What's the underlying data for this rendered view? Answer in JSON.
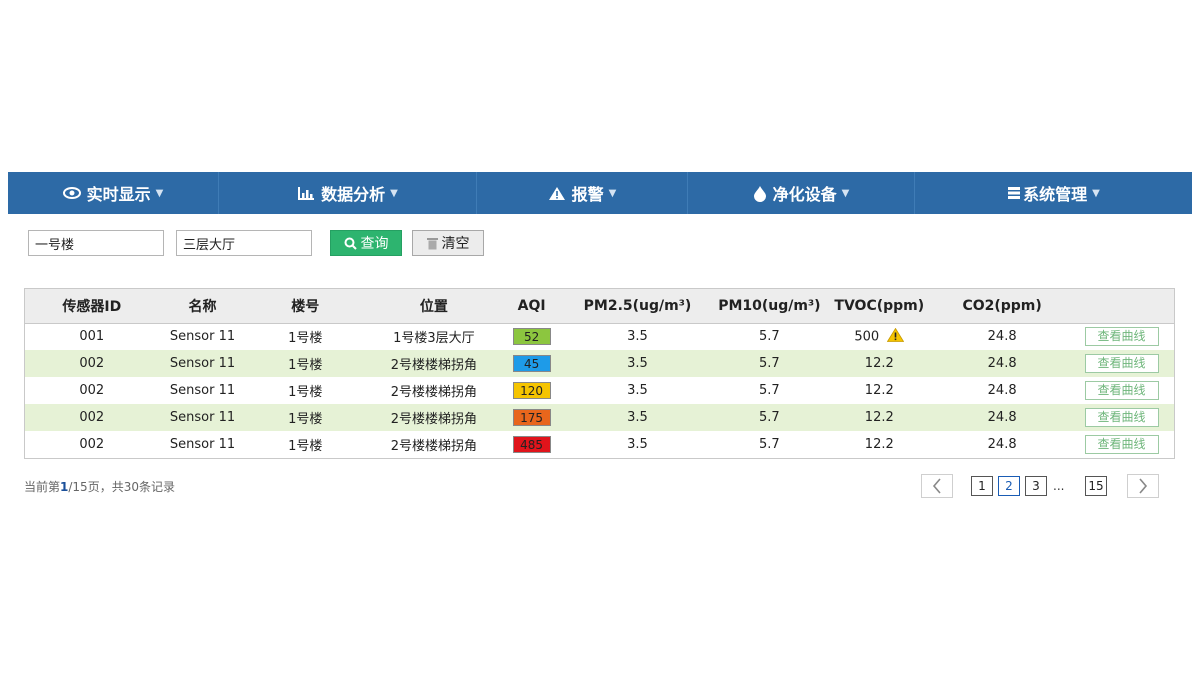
{
  "nav": {
    "items": [
      {
        "label": "实时显示",
        "icon": "eye-icon"
      },
      {
        "label": "数据分析",
        "icon": "bar-chart-icon"
      },
      {
        "label": "报警",
        "icon": "warning-icon"
      },
      {
        "label": "净化设备",
        "icon": "water-drop-icon"
      },
      {
        "label": "系统管理",
        "icon": "list-icon"
      }
    ],
    "background": "#2d6aa6"
  },
  "filter": {
    "building_value": "一号楼",
    "location_value": "三层大厅",
    "search_label": "查询",
    "clear_label": "清空"
  },
  "table": {
    "headers": {
      "id": "传感器ID",
      "name": "名称",
      "building": "楼号",
      "location": "位置",
      "aqi": "AQI",
      "pm25": "PM2.5(ug/m³)",
      "pm10": "PM10(ug/m³)",
      "tvoc": "TVOC(ppm)",
      "co2": "CO2(ppm)"
    },
    "rows": [
      {
        "id": "001",
        "name": "Sensor 11",
        "building": "1号楼",
        "location": "1号楼3层大厅",
        "aqi": "52",
        "aqi_color": "#8cc63f",
        "pm25": "3.5",
        "pm10": "5.7",
        "tvoc": "500",
        "tvoc_warning": true,
        "co2": "24.8",
        "action": "查看曲线"
      },
      {
        "id": "002",
        "name": "Sensor 11",
        "building": "1号楼",
        "location": "2号楼楼梯拐角",
        "aqi": "45",
        "aqi_color": "#1e9be8",
        "pm25": "3.5",
        "pm10": "5.7",
        "tvoc": "12.2",
        "tvoc_warning": false,
        "co2": "24.8",
        "action": "查看曲线"
      },
      {
        "id": "002",
        "name": "Sensor 11",
        "building": "1号楼",
        "location": "2号楼楼梯拐角",
        "aqi": "120",
        "aqi_color": "#f5c400",
        "pm25": "3.5",
        "pm10": "5.7",
        "tvoc": "12.2",
        "tvoc_warning": false,
        "co2": "24.8",
        "action": "查看曲线"
      },
      {
        "id": "002",
        "name": "Sensor 11",
        "building": "1号楼",
        "location": "2号楼楼梯拐角",
        "aqi": "175",
        "aqi_color": "#e8661c",
        "pm25": "3.5",
        "pm10": "5.7",
        "tvoc": "12.2",
        "tvoc_warning": false,
        "co2": "24.8",
        "action": "查看曲线"
      },
      {
        "id": "002",
        "name": "Sensor 11",
        "building": "1号楼",
        "location": "2号楼楼梯拐角",
        "aqi": "485",
        "aqi_color": "#e0141b",
        "pm25": "3.5",
        "pm10": "5.7",
        "tvoc": "12.2",
        "tvoc_warning": false,
        "co2": "24.8",
        "action": "查看曲线"
      }
    ]
  },
  "footer": {
    "status_prefix": "当前第",
    "current_page": "1",
    "status_suffix": "/15页，共30条记录",
    "pages": [
      "1",
      "2",
      "3"
    ],
    "active_page": "2",
    "ellipsis": "...",
    "last_page": "15"
  }
}
